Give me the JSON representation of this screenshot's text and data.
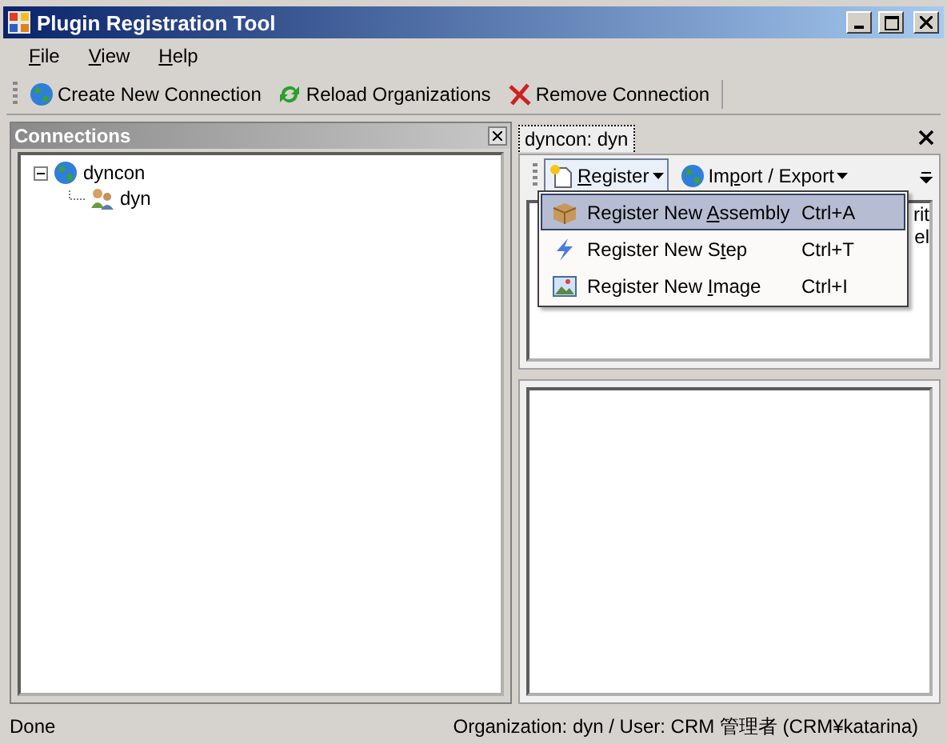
{
  "window": {
    "title": "Plugin Registration Tool"
  },
  "menu": [
    {
      "key": "F",
      "post": "ile"
    },
    {
      "key": "V",
      "post": "iew"
    },
    {
      "key": "H",
      "post": "elp"
    }
  ],
  "toolbar": [
    {
      "kind": "globe",
      "label": "Create New Connection"
    },
    {
      "kind": "reload",
      "label": "Reload Organizations"
    },
    {
      "kind": "remove",
      "label": "Remove Connection"
    }
  ],
  "connections": {
    "title": "Connections",
    "tree": [
      {
        "label": "dyncon",
        "kind": "organization",
        "expanded": true,
        "children": [
          {
            "label": "dyn",
            "kind": "users"
          }
        ]
      }
    ]
  },
  "tabs": [
    {
      "label": "dyncon: dyn",
      "selected": true
    }
  ],
  "org_toolbar": [
    {
      "kind": "new",
      "key": "R",
      "post": "egister",
      "open": true
    },
    {
      "kind": "globe",
      "pre": "Im",
      "key": "p",
      "post": "ort / Export",
      "open": false
    }
  ],
  "register_menu": [
    {
      "kind": "assembly",
      "pre": "Register New ",
      "key": "A",
      "post": "ssembly",
      "shortcut": "Ctrl+A",
      "selected": true
    },
    {
      "kind": "step",
      "pre": "Register New S",
      "key": "t",
      "post": "ep",
      "shortcut": "Ctrl+T",
      "selected": false
    },
    {
      "kind": "image",
      "pre": "Register New ",
      "key": "I",
      "post": "mage",
      "shortcut": "Ctrl+I",
      "selected": false
    }
  ],
  "list_behind_menu": [
    "rit",
    "el"
  ],
  "status_bar": {
    "left": "Done",
    "right": "Organization: dyn / User: CRM 管理者 (CRM¥katarina)"
  }
}
